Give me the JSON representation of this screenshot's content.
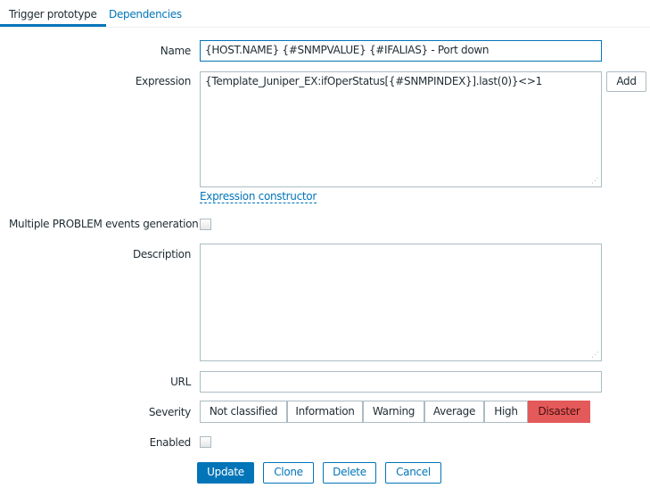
{
  "tabs": [
    {
      "label": "Trigger prototype",
      "active": true
    },
    {
      "label": "Dependencies",
      "active": false
    }
  ],
  "form": {
    "name_label": "Name",
    "name_value": "{HOST.NAME} {#SNMPVALUE} {#IFALIAS} - Port down",
    "expression_label": "Expression",
    "expression_value": "{Template_Juniper_EX:ifOperStatus[{#SNMPINDEX}].last(0)}<>1",
    "add_label": "Add",
    "constructor_link": "Expression constructor",
    "multiple_label": "Multiple PROBLEM events generation",
    "multiple_checked": false,
    "description_label": "Description",
    "description_value": "",
    "url_label": "URL",
    "url_value": "",
    "severity_label": "Severity",
    "severities": [
      "Not classified",
      "Information",
      "Warning",
      "Average",
      "High",
      "Disaster"
    ],
    "selected_severity": "Disaster",
    "disaster_color": "#e45959",
    "enabled_label": "Enabled",
    "enabled_checked": false
  },
  "buttons": {
    "update": "Update",
    "clone": "Clone",
    "delete": "Delete",
    "cancel": "Cancel"
  },
  "colors": {
    "accent": "#0275b8"
  }
}
